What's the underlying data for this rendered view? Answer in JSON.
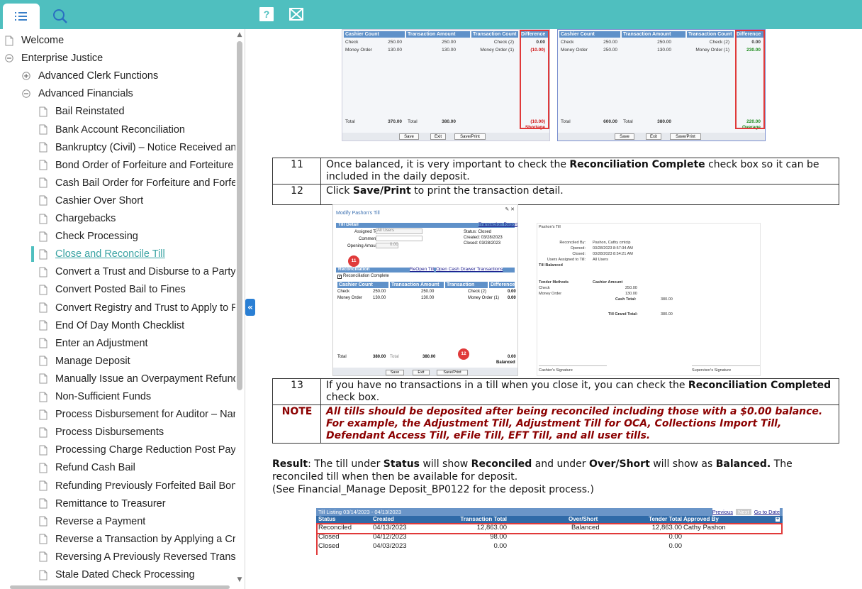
{
  "left_pane": {
    "tree": [
      {
        "label": "Welcome",
        "icon": "page-icon",
        "indent": 0
      },
      {
        "label": "Enterprise Justice",
        "icon": "collapse-icon",
        "indent": 0
      },
      {
        "label": "Advanced Clerk Functions",
        "icon": "expand-icon",
        "indent": 1
      },
      {
        "label": "Advanced Financials",
        "icon": "collapse-icon",
        "indent": 1
      },
      {
        "label": "Bail Reinstated",
        "icon": "page-icon",
        "indent": 2
      },
      {
        "label": "Bank Account Reconciliation",
        "icon": "page-icon",
        "indent": 2
      },
      {
        "label": "Bankruptcy (Civil) – Notice Received and",
        "icon": "page-icon",
        "indent": 2
      },
      {
        "label": "Bond Order of Forfeiture and Forteiture F",
        "icon": "page-icon",
        "indent": 2
      },
      {
        "label": "Cash Bail Order for Forfeiture and Forfeit",
        "icon": "page-icon",
        "indent": 2
      },
      {
        "label": "Cashier Over Short",
        "icon": "page-icon",
        "indent": 2
      },
      {
        "label": "Chargebacks",
        "icon": "page-icon",
        "indent": 2
      },
      {
        "label": "Check Processing",
        "icon": "page-icon",
        "indent": 2
      },
      {
        "label": "Close and Reconcile Till",
        "icon": "page-icon",
        "indent": 2,
        "active": true
      },
      {
        "label": "Convert a Trust and Disburse to a Party",
        "icon": "page-icon",
        "indent": 2
      },
      {
        "label": "Convert Posted Bail to Fines",
        "icon": "page-icon",
        "indent": 2
      },
      {
        "label": "Convert Registry and Trust to Apply to Fe",
        "icon": "page-icon",
        "indent": 2
      },
      {
        "label": "End Of Day Month Checklist",
        "icon": "page-icon",
        "indent": 2
      },
      {
        "label": "Enter an Adjustment",
        "icon": "page-icon",
        "indent": 2
      },
      {
        "label": "Manage Deposit",
        "icon": "page-icon",
        "indent": 2
      },
      {
        "label": "Manually Issue an Overpayment Refund (",
        "icon": "page-icon",
        "indent": 2
      },
      {
        "label": "Non-Sufficient Funds",
        "icon": "page-icon",
        "indent": 2
      },
      {
        "label": "Process Disbursement for Auditor – Nan",
        "icon": "page-icon",
        "indent": 2
      },
      {
        "label": "Process Disbursements",
        "icon": "page-icon",
        "indent": 2
      },
      {
        "label": "Processing Charge Reduction Post Paym",
        "icon": "page-icon",
        "indent": 2
      },
      {
        "label": "Refund Cash Bail",
        "icon": "page-icon",
        "indent": 2
      },
      {
        "label": "Refunding Previously Forfeited Bail Bond",
        "icon": "page-icon",
        "indent": 2
      },
      {
        "label": "Remittance to Treasurer",
        "icon": "page-icon",
        "indent": 2
      },
      {
        "label": "Reverse a Payment",
        "icon": "page-icon",
        "indent": 2
      },
      {
        "label": "Reverse a Transaction by Applying a Crec",
        "icon": "page-icon",
        "indent": 2
      },
      {
        "label": "Reversing A Previously Reversed Transac",
        "icon": "page-icon",
        "indent": 2
      },
      {
        "label": "Stale Dated Check Processing",
        "icon": "page-icon",
        "indent": 2
      }
    ]
  },
  "toolbar": {
    "help_label": "?"
  },
  "shot1": {
    "left": {
      "headers": [
        "Cashier Count",
        "Transaction Amount",
        "Transaction Count",
        "Difference"
      ],
      "rows": [
        [
          "Check",
          "250.00",
          "250.00",
          "Check (2)",
          "0.00"
        ],
        [
          "Money Order",
          "130.00",
          "130.00",
          "Money Order (1)",
          "(10.00)"
        ]
      ],
      "total_label": "Total",
      "total_cashier": "370.00",
      "total_label2": "Total",
      "total_tx": "380.00",
      "diff_total": "(10.00)",
      "diff_word": "Shortage",
      "buttons": [
        "Save",
        "Exit",
        "Save/Print"
      ]
    },
    "right": {
      "headers": [
        "Cashier Count",
        "Transaction Amount",
        "Transaction Count",
        "Difference"
      ],
      "rows": [
        [
          "Check",
          "250.00",
          "250.00",
          "Check (2)",
          "0.00"
        ],
        [
          "Money Order",
          "250.00",
          "130.00",
          "Money Order (1)",
          "230.00"
        ]
      ],
      "total_label": "Total",
      "total_cashier": "600.00",
      "total_label2": "Total",
      "total_tx": "380.00",
      "diff_total": "220.00",
      "diff_word": "Overage",
      "buttons": [
        "Save",
        "Exit",
        "Save/Print"
      ]
    }
  },
  "steps_a": [
    {
      "num": "11",
      "pre": "Once balanced, it is very important to check the ",
      "bold": "Reconciliation Complete",
      "post": " check box so it can be included in the daily deposit."
    },
    {
      "num": "12",
      "pre": "Click ",
      "bold": "Save/Print",
      "post": " to print the transaction detail."
    }
  ],
  "shot2": {
    "form": {
      "title": "Modify Pashon's Till",
      "till_detail": "Till Detail",
      "transaction_report": "Transaction Report",
      "assigned_to": "Assigned To",
      "assigned_val": "All Users",
      "comment": "Comment",
      "opening_amount": "Opening Amount",
      "opening_val": "0.00",
      "status": "Status: Closed",
      "created": "Created: 03/28/2023",
      "closed": "Closed: 03/28/2023",
      "reconciliation": "Reconciliation",
      "reopen": "ReOpen Till",
      "open_cash_drawer": "Open Cash Drawer Transactions",
      "recon_complete": "Reconciliation Complete",
      "headers": [
        "Cashier Count",
        "Transaction Amount",
        "Transaction Count",
        "Difference"
      ],
      "rows": [
        [
          "Check",
          "250.00",
          "250.00",
          "Check (2)",
          "0.00"
        ],
        [
          "Money Order",
          "130.00",
          "130.00",
          "Money Order (1)",
          "0.00"
        ]
      ],
      "total": "Total",
      "total_cashier": "380.00",
      "total2": "Total",
      "total_tx": "380.00",
      "diff_total": "0.00",
      "balanced": "Balanced",
      "buttons": [
        "Save",
        "Exit",
        "Save/Print"
      ],
      "callout_a": "11",
      "callout_b": "12"
    },
    "report": {
      "title": "Pashon's Till",
      "lines": [
        [
          "Reconciled By:",
          "Pashon, Cathy cmtcip"
        ],
        [
          "Opened:",
          "03/28/2023 8:57:34 AM"
        ],
        [
          "Closed:",
          "03/28/2023 8:54:21 AM"
        ],
        [
          "Users Assigned to Till:",
          "All Users"
        ]
      ],
      "till_balanced": "Till Balanced",
      "tender_methods": "Tender Methods",
      "cashier_amount": "Cashier Amount",
      "tender_rows": [
        [
          "Check",
          "250.00"
        ],
        [
          "Money Order",
          "130.00"
        ]
      ],
      "cash_total_label": "Cash Total:",
      "cash_total": "380.00",
      "grand_total_label": "Till Grand Total:",
      "grand_total": "380.00",
      "cashier_sig": "Cashier's Signature",
      "supervisor_sig": "Supervisor's Signature"
    }
  },
  "steps_b": {
    "num": "13",
    "pre": "If you have no transactions in a till when you close it, you can check the ",
    "bold": "Reconciliation Completed",
    "post": " check box.",
    "note_label": "NOTE",
    "note_text": "All tills should be deposited after being reconciled including those with a $0.00 balance. For example, the Adjustment Till, Adjustment Till for OCA, Collections Import Till, Defendant Access Till, eFile Till, EFT Till, and all user tills."
  },
  "result": {
    "label": "Result",
    "t1": ": The till under ",
    "b1": "Status",
    "t2": " will show ",
    "b2": "Reconciled",
    "t3": " and under ",
    "b3": "Over/Short",
    "t4": " will show as ",
    "b4": "Balanced.",
    "t5": " The reconciled till when then be available for deposit.",
    "line3": "(See Financial_Manage Deposit_BP0122 for the deposit process.)"
  },
  "till_listing": {
    "title": "Till Listing 03/14/2023 - 04/13/2023",
    "previous": "Previous",
    "next": "Next",
    "goto": "Go to Date",
    "headers": [
      "Status",
      "Created",
      "Transaction Total",
      "Over/Short",
      "Tender Total",
      "Approved By"
    ],
    "rows": [
      [
        "Reconciled",
        "04/13/2023",
        "12,863.00",
        "Balanced",
        "12,863.00",
        "Cathy Pashon"
      ],
      [
        "Closed",
        "04/12/2023",
        "98.00",
        "",
        "0.00",
        ""
      ],
      [
        "Closed",
        "04/03/2023",
        "0.00",
        "",
        "0.00",
        ""
      ]
    ]
  }
}
